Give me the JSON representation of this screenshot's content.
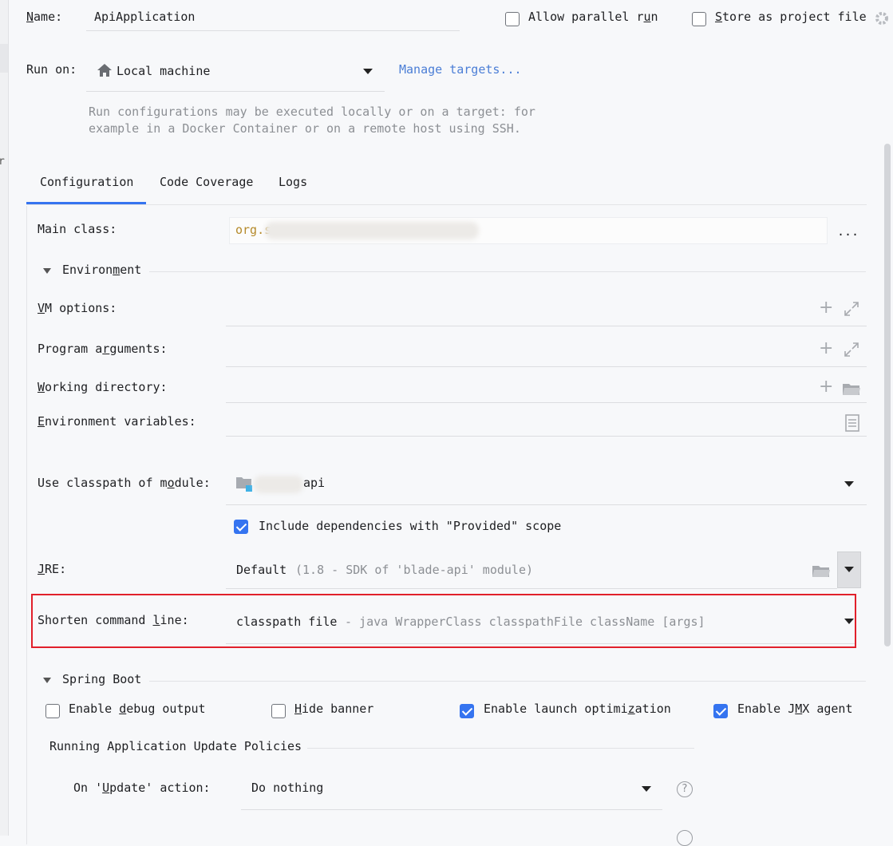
{
  "name": {
    "label": "Name:",
    "value": "ApiApplication"
  },
  "options": {
    "allow_parallel": {
      "label": "Allow parallel run",
      "checked": false
    },
    "store_project": {
      "label": "Store as project file",
      "checked": false
    }
  },
  "run_on": {
    "label": "Run on:",
    "value": "Local machine",
    "manage_link": "Manage targets...",
    "hint_line1": "Run configurations may be executed locally or on a target: for",
    "hint_line2": "example in a Docker Container or on a remote host using SSH."
  },
  "tabs": [
    {
      "label": "Configuration",
      "active": true
    },
    {
      "label": "Code Coverage",
      "active": false
    },
    {
      "label": "Logs",
      "active": false
    }
  ],
  "main_class": {
    "label": "Main class:",
    "value_prefix": "org.s",
    "more": "..."
  },
  "environment": {
    "header": "Environment",
    "vm_options": "VM options:",
    "program_args": "Program arguments:",
    "working_dir": "Working directory:",
    "env_vars": "Environment variables:"
  },
  "classpath": {
    "label": "Use classpath of module:",
    "module_suffix": "api",
    "include_label": "Include dependencies with \"Provided\" scope",
    "include_checked": true
  },
  "jre": {
    "label": "JRE:",
    "value": "Default",
    "detail": "(1.8 - SDK of 'blade-api' module)"
  },
  "shorten": {
    "label": "Shorten command line:",
    "value": "classpath file",
    "detail": "- java WrapperClass classpathFile className [args]"
  },
  "spring_boot": {
    "header": "Spring Boot",
    "debug": {
      "label": "Enable debug output",
      "checked": false
    },
    "banner": {
      "label": "Hide banner",
      "checked": false
    },
    "launch_opt": {
      "label": "Enable launch optimization",
      "checked": true
    },
    "jmx": {
      "label": "Enable JMX agent",
      "checked": true
    },
    "policies_header": "Running Application Update Policies",
    "on_update_label": "On 'Update' action:",
    "on_update_value": "Do nothing",
    "help": "?"
  },
  "colors": {
    "accent": "#3574f0",
    "link": "#4b7ed6",
    "highlight_border": "#e1202b",
    "main_class_text": "#b58a2a"
  }
}
